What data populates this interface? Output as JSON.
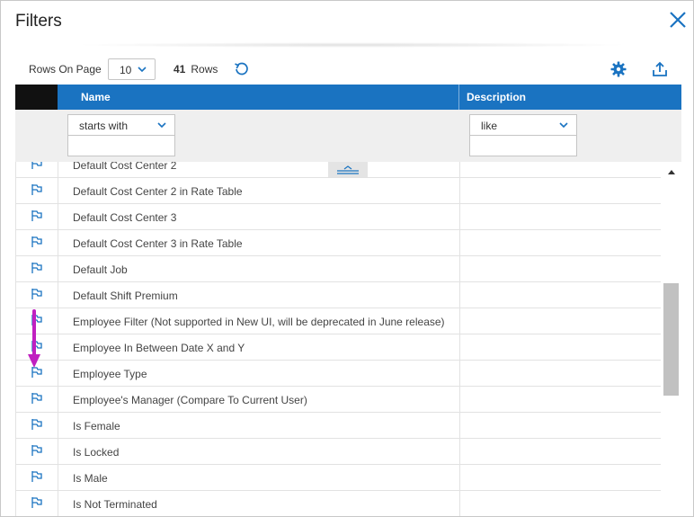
{
  "dialog": {
    "title": "Filters",
    "close_icon": "close-icon"
  },
  "toolbar": {
    "rows_on_page_label": "Rows On Page",
    "rows_on_page_value": "10",
    "rows_count": "41",
    "rows_label": "Rows",
    "refresh_icon": "refresh-icon",
    "settings_icon": "gear-icon",
    "export_icon": "upload-icon"
  },
  "table": {
    "columns": [
      {
        "label": "Name"
      },
      {
        "label": "Description"
      }
    ],
    "filters": {
      "name_operator": "starts with",
      "name_value": "",
      "description_operator": "like",
      "description_value": ""
    },
    "rows": [
      {
        "name": "Default Cost Center 2",
        "description": ""
      },
      {
        "name": "Default Cost Center 2 in Rate Table",
        "description": ""
      },
      {
        "name": "Default Cost Center 3",
        "description": ""
      },
      {
        "name": "Default Cost Center 3 in Rate Table",
        "description": ""
      },
      {
        "name": "Default Job",
        "description": ""
      },
      {
        "name": "Default Shift Premium",
        "description": ""
      },
      {
        "name": "Employee Filter (Not supported in New UI, will be deprecated in June release)",
        "description": ""
      },
      {
        "name": "Employee In Between Date X and Y",
        "description": ""
      },
      {
        "name": "Employee Type",
        "description": ""
      },
      {
        "name": "Employee's Manager (Compare To Current User)",
        "description": ""
      },
      {
        "name": "Is Female",
        "description": ""
      },
      {
        "name": "Is Locked",
        "description": ""
      },
      {
        "name": "Is Male",
        "description": ""
      },
      {
        "name": "Is Not Terminated",
        "description": ""
      }
    ]
  },
  "colors": {
    "header_blue": "#1a73c1",
    "icon_blue": "#1a73c1",
    "annotation_magenta": "#c020c0"
  }
}
